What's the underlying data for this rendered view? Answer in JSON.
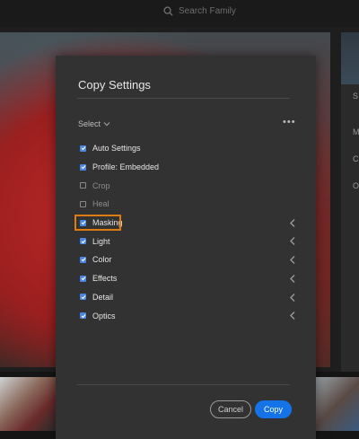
{
  "search": {
    "placeholder": "Search Family",
    "icon": "search-icon"
  },
  "dialog": {
    "title": "Copy Settings",
    "select_label": "Select",
    "more_icon": "more-icon",
    "items": [
      {
        "label": "Auto Settings",
        "checked": true,
        "expandable": false
      },
      {
        "label": "Profile: Embedded",
        "checked": true,
        "expandable": false
      },
      {
        "label": "Crop",
        "checked": false,
        "expandable": false
      },
      {
        "label": "Heal",
        "checked": false,
        "expandable": false
      },
      {
        "label": "Masking",
        "checked": true,
        "expandable": true,
        "highlighted": true
      },
      {
        "label": "Light",
        "checked": true,
        "expandable": true
      },
      {
        "label": "Color",
        "checked": true,
        "expandable": true
      },
      {
        "label": "Effects",
        "checked": true,
        "expandable": true
      },
      {
        "label": "Detail",
        "checked": true,
        "expandable": true
      },
      {
        "label": "Optics",
        "checked": true,
        "expandable": true
      }
    ],
    "cancel_label": "Cancel",
    "copy_label": "Copy"
  },
  "right_panel": {
    "letters": [
      "S",
      "M",
      "C",
      "O"
    ]
  },
  "colors": {
    "accent": "#1473e6",
    "checkbox": "#4a86e8",
    "highlight": "#e07a12",
    "dialog_bg": "#323232"
  }
}
